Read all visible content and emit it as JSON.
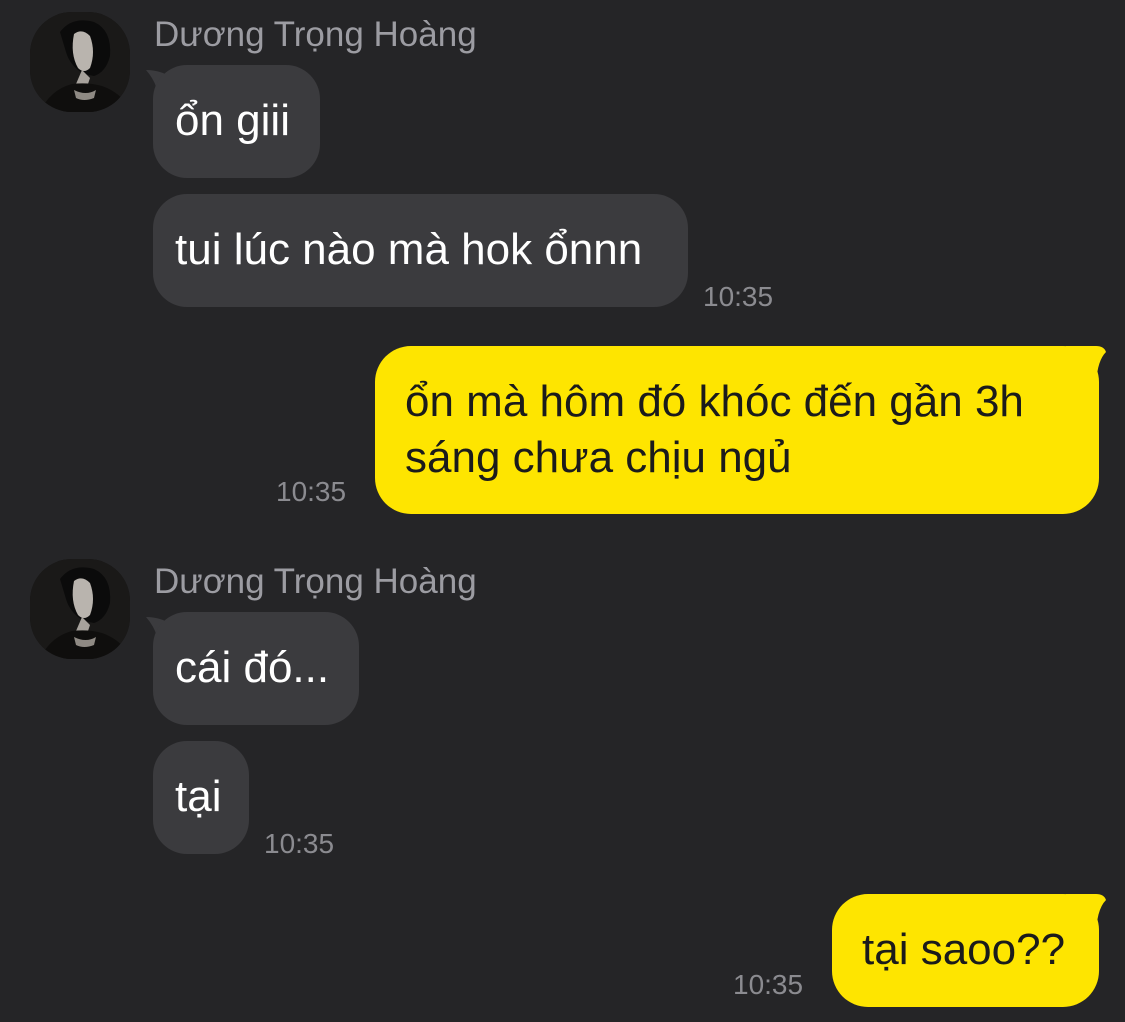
{
  "colors": {
    "background": "#252527",
    "incoming_bubble": "#3b3b3e",
    "outgoing_bubble": "#fee500",
    "name_text": "#9c9ca2",
    "time_text": "#8b8b90"
  },
  "messages": [
    {
      "sender": "Dương Trọng Hoàng",
      "direction": "incoming",
      "avatar": "profile-photo",
      "bubbles": [
        "ổn giii",
        "tui lúc nào mà hok ổnnn"
      ],
      "time": "10:35"
    },
    {
      "direction": "outgoing",
      "lines": [
        "ổn mà hôm đó khóc đến gần 3h",
        "sáng chưa chịu ngủ"
      ],
      "time": "10:35"
    },
    {
      "sender": "Dương Trọng Hoàng",
      "direction": "incoming",
      "avatar": "profile-photo",
      "bubbles": [
        "cái đó...",
        "tại"
      ],
      "time": "10:35"
    },
    {
      "direction": "outgoing",
      "lines": [
        "tại saoo??"
      ],
      "time": "10:35"
    }
  ]
}
